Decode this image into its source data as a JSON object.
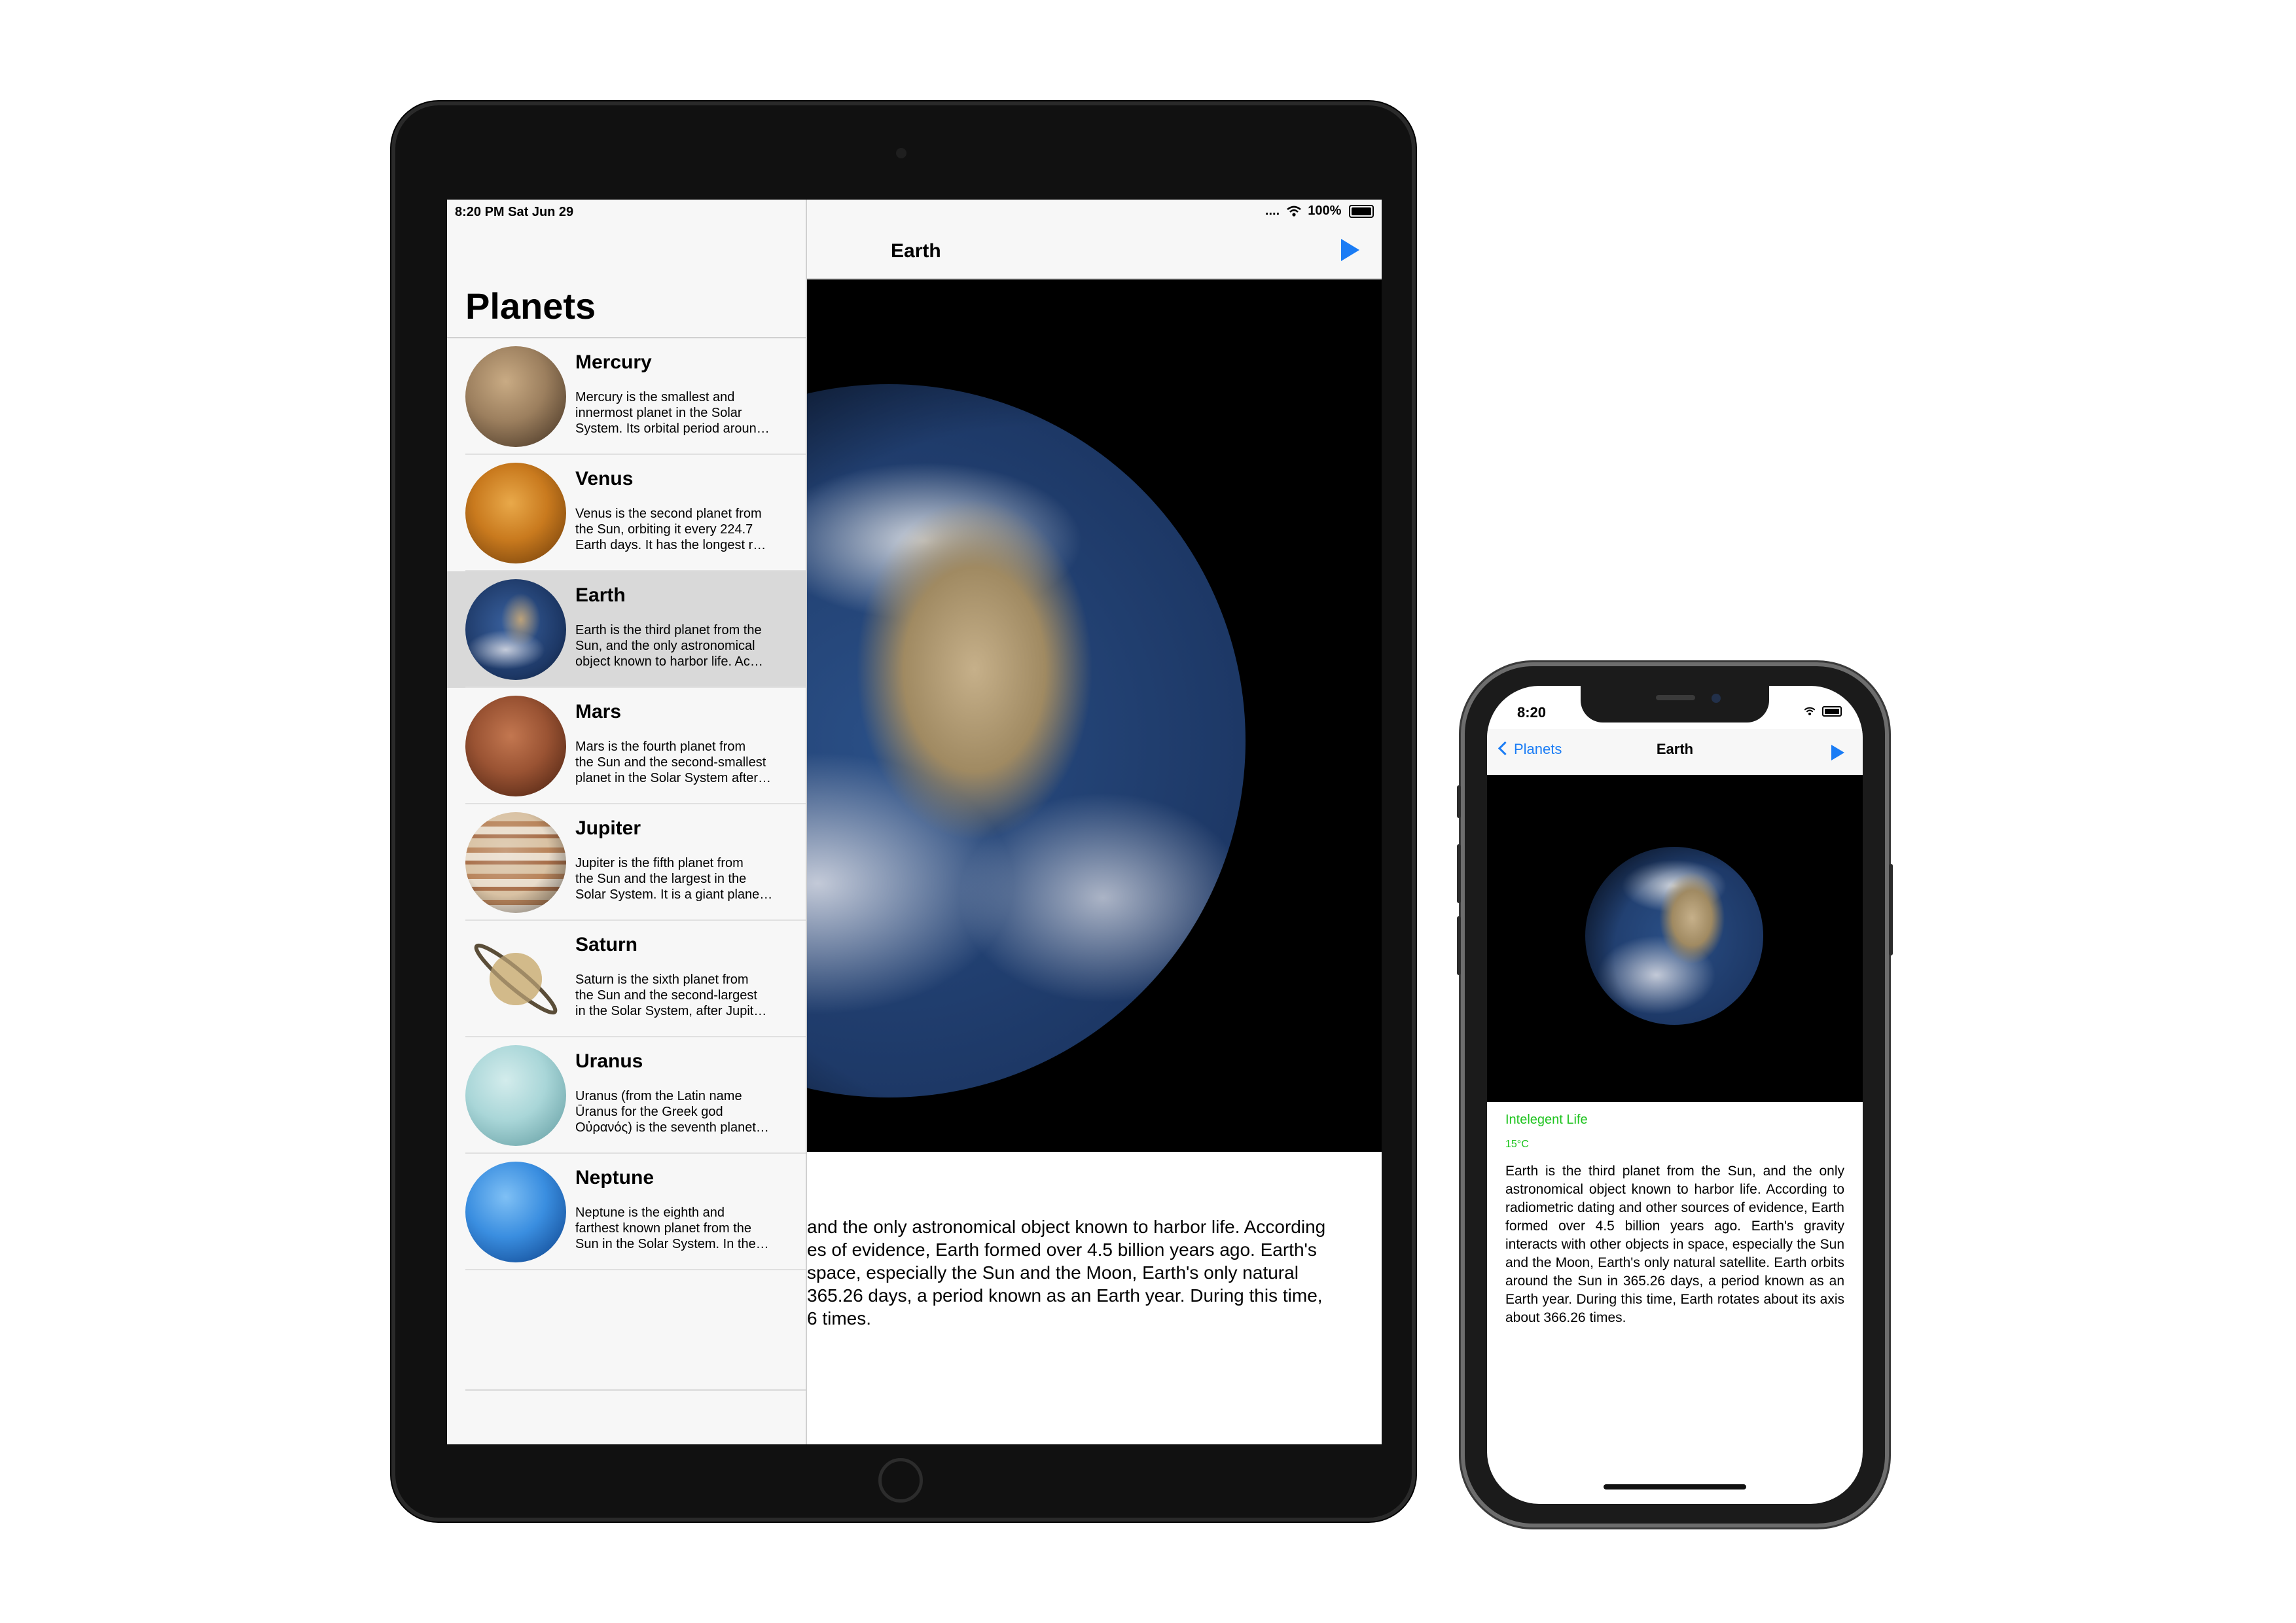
{
  "ipad": {
    "status": {
      "time": "8:20 PM   Sat Jun 29",
      "signal": "....",
      "battery": "100%"
    },
    "master": {
      "title": "Planets",
      "items": [
        {
          "name": "Mercury",
          "desc": "Mercury is the smallest and\ninnermost planet in the Solar\nSystem. Its orbital period aroun…"
        },
        {
          "name": "Venus",
          "desc": "Venus is the second planet from\nthe Sun, orbiting it every 224.7\nEarth days. It has the longest r…"
        },
        {
          "name": "Earth",
          "desc": "Earth is the third planet from the\nSun, and the only astronomical\nobject known to harbor life. Ac…"
        },
        {
          "name": "Mars",
          "desc": "Mars is the fourth planet from\nthe Sun and the second-smallest\nplanet in the Solar System after…"
        },
        {
          "name": "Jupiter",
          "desc": "Jupiter is the fifth planet from\nthe Sun and the largest in the\nSolar System. It is a giant plane…"
        },
        {
          "name": "Saturn",
          "desc": "Saturn is the sixth planet from\nthe Sun and the second-largest\nin the Solar System, after Jupit…"
        },
        {
          "name": "Uranus",
          "desc": "Uranus (from the Latin name\nŪranus for the Greek god\nΟὐρανός) is the seventh planet…"
        },
        {
          "name": "Neptune",
          "desc": "Neptune is the eighth and\nfarthest known planet from the\nSun in the Solar System. In the…"
        }
      ]
    },
    "detail": {
      "title": "Earth",
      "text": "and the only astronomical object known to harbor life. According\nes of evidence, Earth formed over 4.5 billion years ago. Earth's\nspace, especially the Sun and the Moon, Earth's only natural\n365.26 days, a period known as an Earth year. During this time,\n6 times."
    }
  },
  "iphone": {
    "status": {
      "time": "8:20"
    },
    "nav": {
      "back": "Planets",
      "title": "Earth"
    },
    "life": "Intelegent Life",
    "temp": "15°C",
    "text": "Earth is the third planet from the Sun, and the only astronomical object known to harbor life. According to radiometric dating and other sources of evidence, Earth formed over 4.5 billion years ago. Earth's gravity interacts with other objects in space, especially the Sun and the Moon, Earth's only natural satellite. Earth orbits around the Sun in 365.26 days, a period known as an Earth year. During this time, Earth rotates about its axis about 366.26 times."
  },
  "colors": {
    "accent": "#1a7cf5",
    "life_green": "#1cc31c"
  },
  "icons": [
    "play-icon",
    "back-chevron-icon",
    "wifi-icon",
    "battery-icon"
  ]
}
